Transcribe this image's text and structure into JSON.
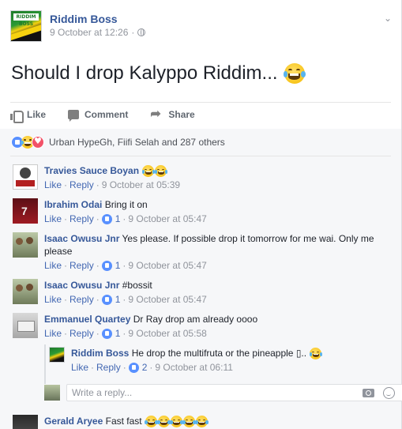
{
  "post": {
    "page_name": "Riddim Boss",
    "avatar_badge": "RIDDIM BOSS",
    "timestamp": "9 October at 12:26",
    "separator": "·",
    "text": "Should I drop Kalyppo Riddim...",
    "actions": {
      "like": "Like",
      "comment": "Comment",
      "share": "Share"
    }
  },
  "reactions": {
    "summary": "Urban HypeGh, Fiifi Selah and 287 others",
    "types": [
      "like",
      "haha",
      "love"
    ]
  },
  "comments": [
    {
      "name": "Travies Sauce Boyan",
      "text": "",
      "emoji_count": 2,
      "like": "Like",
      "reply": "Reply",
      "likes": "",
      "time": "9 October at 05:39"
    },
    {
      "name": "Ibrahim Odai",
      "text": "Bring it on",
      "emoji_count": 0,
      "like": "Like",
      "reply": "Reply",
      "likes": "1",
      "time": "9 October at 05:47"
    },
    {
      "name": "Isaac Owusu Jnr",
      "text": "Yes please. If possible drop it tomorrow for me wai. Only me please",
      "emoji_count": 0,
      "like": "Like",
      "reply": "Reply",
      "likes": "1",
      "time": "9 October at 05:47"
    },
    {
      "name": "Isaac Owusu Jnr",
      "text": "#bossit",
      "emoji_count": 0,
      "like": "Like",
      "reply": "Reply",
      "likes": "1",
      "time": "9 October at 05:47"
    },
    {
      "name": "Emmanuel Quartey",
      "text": "Dr Ray drop am already oooo",
      "emoji_count": 0,
      "like": "Like",
      "reply": "Reply",
      "likes": "1",
      "time": "9 October at 05:58"
    },
    {
      "name": "Gerald Aryee",
      "text": "Fast fast",
      "emoji_count": 5
    }
  ],
  "reply": {
    "name": "Riddim Boss",
    "text": "He drop the multifruta or the pineapple ▯..",
    "emoji_count": 1,
    "like": "Like",
    "reply": "Reply",
    "likes": "2",
    "time": "9 October at 06:11"
  },
  "reply_input": {
    "placeholder": "Write a reply..."
  },
  "colors": {
    "link": "#365899",
    "action": "#4267b2",
    "meta": "#90949c",
    "like_blue": "#5890ff",
    "love_red": "#f25268",
    "comments_bg": "#f6f7f9"
  }
}
